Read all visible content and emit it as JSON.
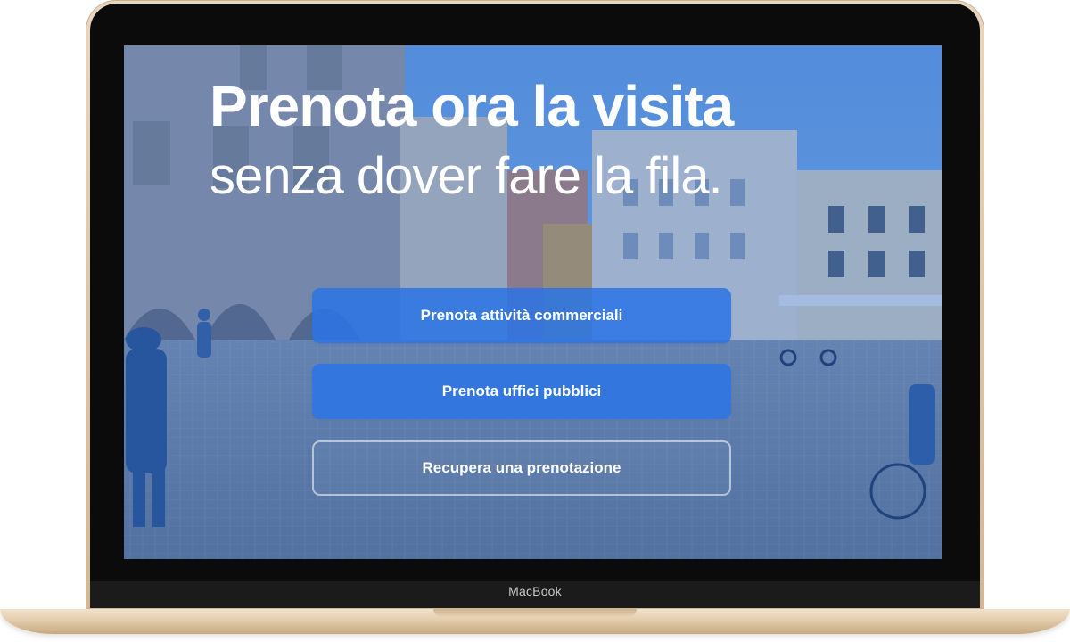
{
  "device": {
    "brand_label": "MacBook"
  },
  "hero": {
    "title_bold": "Prenota ora la visita",
    "title_light": "senza dover fare la fila."
  },
  "actions": {
    "commercial_label": "Prenota attività commerciali",
    "public_offices_label": "Prenota uffici pubblici",
    "recover_label": "Recupera una prenotazione"
  },
  "colors": {
    "overlay_blue": "#2560c4",
    "button_blue": "#2a74e6",
    "laptop_gold": "#d9c3a3"
  }
}
